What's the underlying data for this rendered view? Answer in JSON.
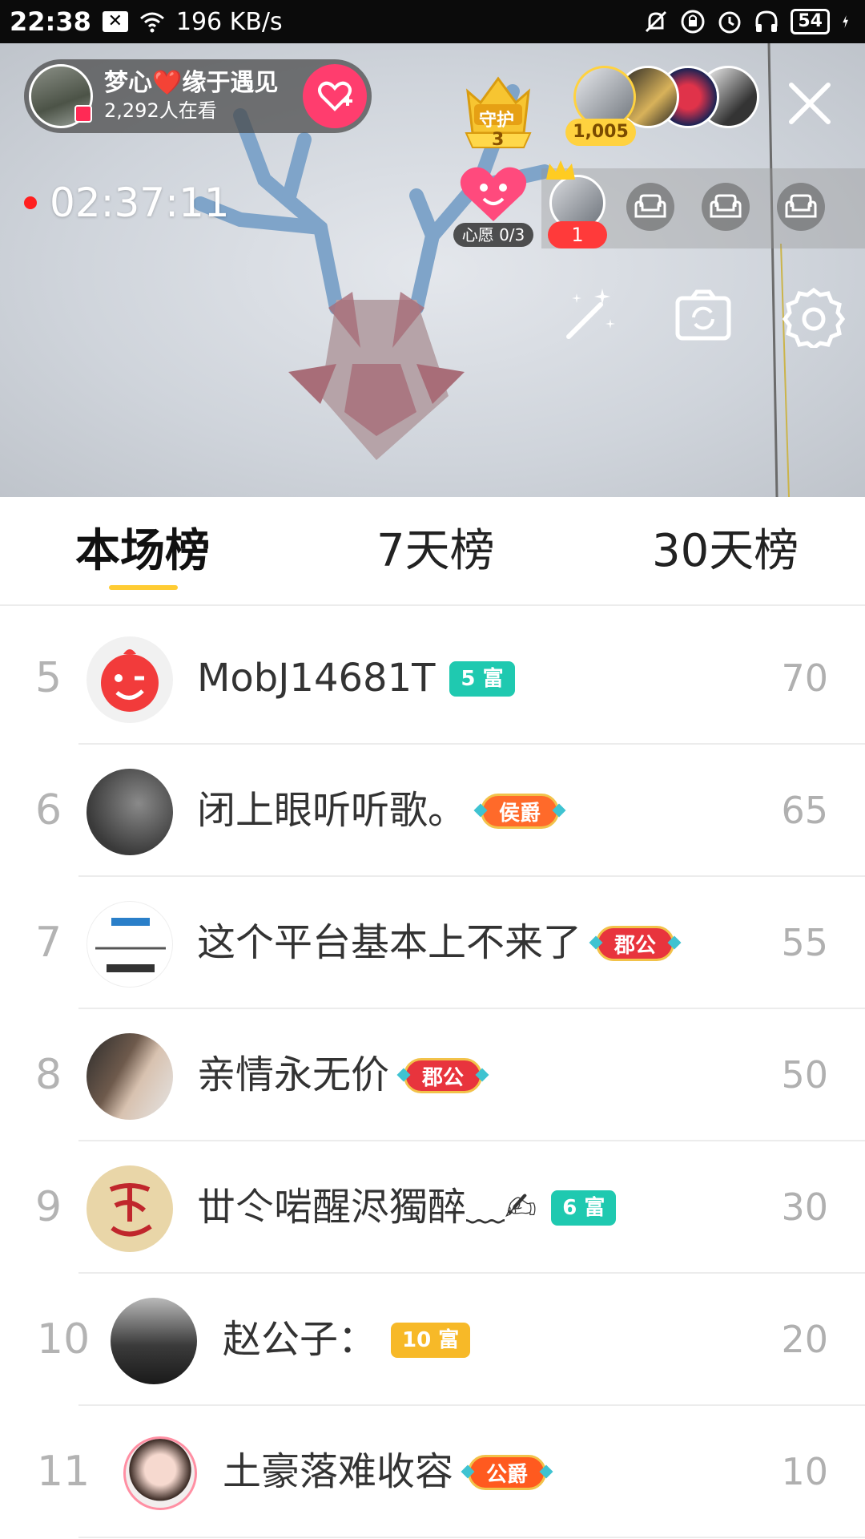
{
  "status_bar": {
    "time": "22:38",
    "network_speed": "196 KB/s",
    "battery": "54"
  },
  "live": {
    "host_name": "梦心❤️缘于遇见",
    "viewers": "2,292人在看",
    "guard_label": "守护",
    "guard_count": "3",
    "top_viewer_count": "1,005",
    "timer": "02:37:11",
    "wish_label": "心愿 0/3",
    "top_seat_rank": "1"
  },
  "tabs": [
    {
      "label": "本场榜",
      "active": true
    },
    {
      "label": "7天榜",
      "active": false
    },
    {
      "label": "30天榜",
      "active": false
    }
  ],
  "ranking": [
    {
      "rank": "5",
      "name": "MobJ14681T",
      "badge": "5 富",
      "badge_type": "rich",
      "badge_color": "#1fc9b0",
      "score": "70"
    },
    {
      "rank": "6",
      "name": "闭上眼听听歌。",
      "badge": "侯爵",
      "badge_type": "noble",
      "badge_color": "#ff6a2a",
      "score": "65"
    },
    {
      "rank": "7",
      "name": "这个平台基本上不来了",
      "badge": "郡公",
      "badge_type": "noble",
      "badge_color": "#e8343d",
      "score": "55"
    },
    {
      "rank": "8",
      "name": "亲情永无价",
      "badge": "郡公",
      "badge_type": "noble",
      "badge_color": "#e8343d",
      "score": "50"
    },
    {
      "rank": "9",
      "name": "丗仒啱醒浕獨醉﹏✍",
      "badge": "6 富",
      "badge_type": "rich",
      "badge_color": "#1fc9b0",
      "score": "30"
    },
    {
      "rank": "10",
      "name": "赵公子：",
      "badge": "10 富",
      "badge_type": "rich",
      "badge_color": "#f7b928",
      "score": "20"
    },
    {
      "rank": "11",
      "name": "土豪落难收容",
      "badge": "公爵",
      "badge_type": "noble",
      "badge_color": "#ff5a1f",
      "score": "10"
    }
  ],
  "colors": {
    "accent": "#ffcc33",
    "follow": "#ff3d6e"
  }
}
